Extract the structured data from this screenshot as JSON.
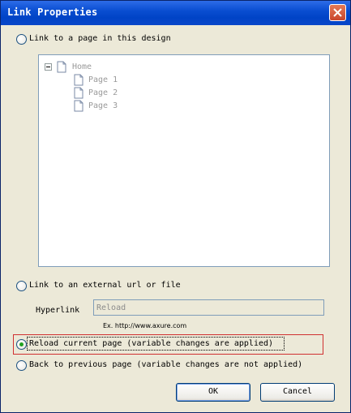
{
  "window": {
    "title": "Link Properties"
  },
  "options": {
    "link_page": {
      "label": "Link to a page in this design",
      "selected": false
    },
    "link_external": {
      "label": "Link to an external url or file",
      "selected": false
    },
    "reload": {
      "label": "Reload current page (variable changes are applied)",
      "selected": true
    },
    "back": {
      "label": "Back to previous page (variable changes are not applied)",
      "selected": false
    }
  },
  "tree": {
    "root": "Home",
    "children": [
      "Page 1",
      "Page 2",
      "Page 3"
    ]
  },
  "hyperlink": {
    "label": "Hyperlink",
    "value": "Reload",
    "hint": "Ex. http://www.axure.com"
  },
  "buttons": {
    "ok": "OK",
    "cancel": "Cancel"
  },
  "colors": {
    "highlight_border": "#d03030",
    "title_bar": "#0a4ed1",
    "radio_dot": "#21a121"
  }
}
